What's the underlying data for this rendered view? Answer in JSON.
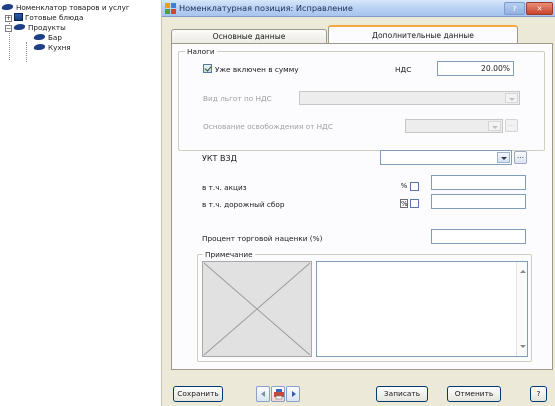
{
  "tree": {
    "root": "Номенклатор товаров и услуг",
    "items": [
      {
        "label": "Готовые блюда"
      },
      {
        "label": "Продукты"
      },
      {
        "label": "Бар"
      },
      {
        "label": "Кухня"
      }
    ]
  },
  "window": {
    "title": "Номенклатурная позиция: Исправление",
    "help_label": "?",
    "close_label": "✕"
  },
  "tabs": [
    {
      "label": "Основные данные",
      "active": false
    },
    {
      "label": "Дополнительные данные",
      "active": true
    }
  ],
  "taxes": {
    "legend": "Налоги",
    "included_label": "Уже включен в сумму",
    "included_checked": true,
    "vat_label": "НДС",
    "vat_value": "20.00%",
    "vat_exempt_type_label": "Вид льгот по НДС",
    "vat_exempt_basis_label": "Основание освобождения от НДС"
  },
  "ukt": {
    "label": "УКТ ВЗД",
    "excise_label": "в т.ч. акциз",
    "excise_unit": "%",
    "road_label": "в т.ч. дорожный сбор",
    "road_unit": "%"
  },
  "markup": {
    "label": "Процент торговой наценки (%)"
  },
  "note": {
    "legend": "Примечание"
  },
  "buttons": {
    "save": "Сохранить",
    "record": "Записать",
    "cancel": "Отменить",
    "help": "?"
  },
  "colors": {
    "tab_accent": "#f6a83e",
    "window_bg": "#ece9d8"
  }
}
